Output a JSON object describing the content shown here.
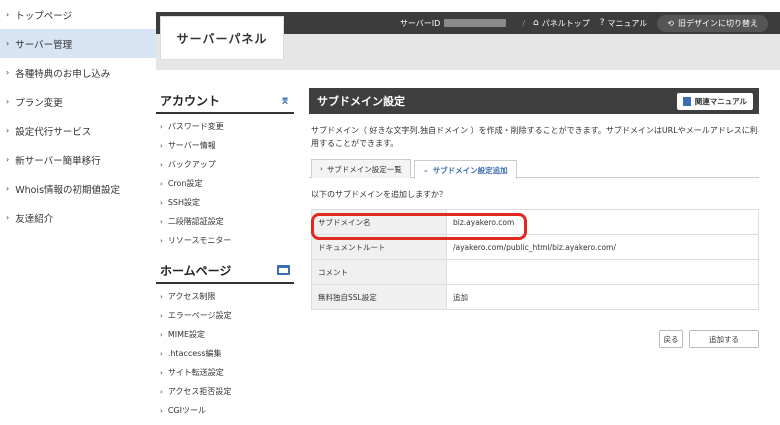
{
  "leftnav": {
    "items": [
      {
        "label": "トップページ"
      },
      {
        "label": "サーバー管理"
      },
      {
        "label": "各種特典のお申し込み"
      },
      {
        "label": "プラン変更"
      },
      {
        "label": "設定代行サービス"
      },
      {
        "label": "新サーバー簡単移行"
      },
      {
        "label": "Whois情報の初期値設定"
      },
      {
        "label": "友達紹介"
      }
    ],
    "active_index": 1
  },
  "topbar": {
    "server_id_label": "サーバーID",
    "separator": "/",
    "panel_top": "パネルトップ",
    "manual": "マニュアル",
    "old_design": "旧デザインに切り替え"
  },
  "logo": {
    "text": "サーバーパネル"
  },
  "menu": {
    "account": {
      "title": "アカウント",
      "items": [
        "パスワード変更",
        "サーバー情報",
        "バックアップ",
        "Cron設定",
        "SSH設定",
        "二段階認証設定",
        "リソースモニター"
      ]
    },
    "homepage": {
      "title": "ホームページ",
      "items": [
        "アクセス制限",
        "エラーページ設定",
        "MIME設定",
        ".htaccess編集",
        "サイト転送設定",
        "アクセス拒否設定",
        "CGIツール"
      ]
    }
  },
  "main": {
    "title": "サブドメイン設定",
    "manual_button": "関連マニュアル",
    "description": "サブドメイン（ 好きな文字列.独自ドメイン ）を作成・削除することができます。サブドメインはURLやメールアドレスに利用することができます。",
    "tabs": [
      {
        "label": "サブドメイン設定一覧"
      },
      {
        "label": "サブドメイン設定追加"
      }
    ],
    "confirm": "以下のサブドメインを追加しますか？",
    "rows": [
      {
        "label": "サブドメイン名",
        "value": "biz.ayakero.com"
      },
      {
        "label": "ドキュメントルート",
        "value": "/ayakero.com/public_html/biz.ayakero.com/"
      },
      {
        "label": "コメント",
        "value": ""
      },
      {
        "label": "無料独自SSL設定",
        "value": "追加"
      }
    ],
    "back_button": "戻る",
    "add_button": "追加する"
  },
  "colors": {
    "accent": "#3b6db4",
    "highlight": "#e02a20",
    "topbar": "#3c3c3c",
    "active_nav": "#d6e4f3"
  }
}
